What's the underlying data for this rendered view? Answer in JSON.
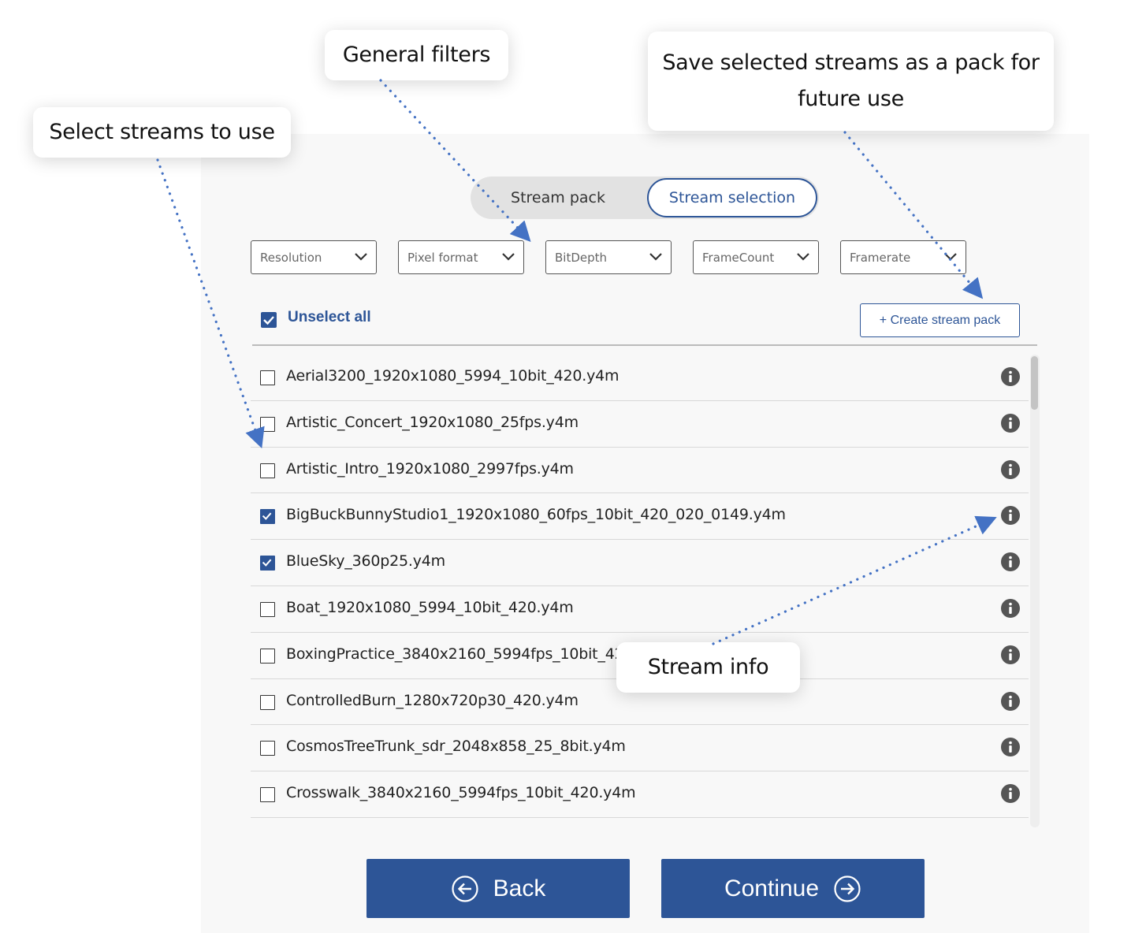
{
  "toggle": {
    "pack_label": "Stream pack",
    "selection_label": "Stream selection"
  },
  "filters": [
    "Resolution",
    "Pixel format",
    "BitDepth",
    "FrameCount",
    "Framerate"
  ],
  "unselect_all": "Unselect all",
  "create_pack": "+ Create stream pack",
  "streams": [
    {
      "name": "Aerial3200_1920x1080_5994_10bit_420.y4m",
      "checked": false
    },
    {
      "name": "Artistic_Concert_1920x1080_25fps.y4m",
      "checked": false
    },
    {
      "name": "Artistic_Intro_1920x1080_2997fps.y4m",
      "checked": false
    },
    {
      "name": "BigBuckBunnyStudio1_1920x1080_60fps_10bit_420_020_0149.y4m",
      "checked": true
    },
    {
      "name": "BlueSky_360p25.y4m",
      "checked": true
    },
    {
      "name": "Boat_1920x1080_5994_10bit_420.y4m",
      "checked": false
    },
    {
      "name": "BoxingPractice_3840x2160_5994fps_10bit_420.y4m",
      "checked": false
    },
    {
      "name": "ControlledBurn_1280x720p30_420.y4m",
      "checked": false
    },
    {
      "name": "CosmosTreeTrunk_sdr_2048x858_25_8bit.y4m",
      "checked": false
    },
    {
      "name": "Crosswalk_3840x2160_5994fps_10bit_420.y4m",
      "checked": false
    }
  ],
  "buttons": {
    "back": "Back",
    "continue": "Continue"
  },
  "callouts": {
    "select": "Select streams to use",
    "filters": "General filters",
    "save_line1": "Save selected streams as a pack for",
    "save_line2": "future use",
    "info": "Stream info"
  },
  "colors": {
    "accent": "#2d5597",
    "panel": "#f8f8f8",
    "arrow": "#4472c4"
  }
}
